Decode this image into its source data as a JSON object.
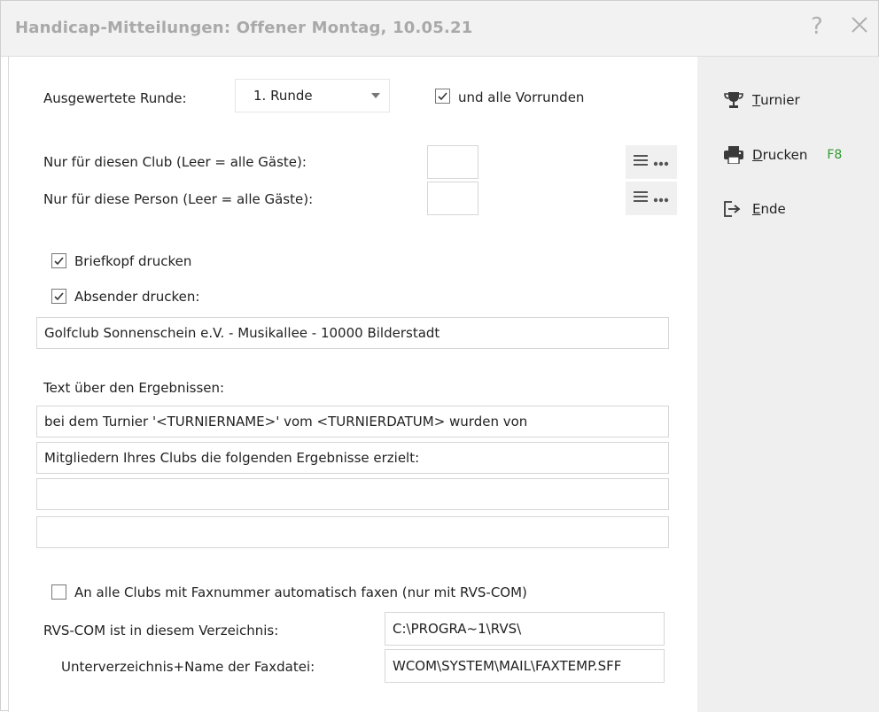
{
  "window": {
    "title": "Handicap-Mitteilungen: Offener Montag, 10.05.21",
    "help_glyph": "?"
  },
  "round": {
    "label": "Ausgewertete Runde:",
    "selected": "1. Runde",
    "all_previous_label": "und alle Vorrunden",
    "all_previous_checked": true
  },
  "club_filter": {
    "label": "Nur für diesen Club (Leer = alle Gäste):",
    "value": ""
  },
  "person_filter": {
    "label": "Nur für diese Person (Leer = alle Gäste):",
    "value": ""
  },
  "letterhead": {
    "label": "Briefkopf drucken",
    "checked": true
  },
  "sender": {
    "label": "Absender drucken:",
    "checked": true,
    "value": "Golfclub Sonnenschein e.V. - Musikallee - 10000 Bilderstadt"
  },
  "results_text": {
    "label": "Text über den Ergebnissen:",
    "lines": [
      "bei dem Turnier '<TURNIERNAME>' vom <TURNIERDATUM> wurden von",
      "Mitgliedern Ihres Clubs die folgenden Ergebnisse erzielt:",
      "",
      ""
    ]
  },
  "fax": {
    "auto_label": "An alle Clubs mit Faxnummer automatisch faxen (nur mit RVS-COM)",
    "auto_checked": false,
    "dir_label": "RVS-COM ist in diesem Verzeichnis:",
    "dir_value": "C:\\PROGRA~1\\RVS\\",
    "file_label": "Unterverzeichnis+Name der Faxdatei:",
    "file_value": "WCOM\\SYSTEM\\MAIL\\FAXTEMP.SFF"
  },
  "sidebar": {
    "turnier": {
      "first": "T",
      "rest": "urnier"
    },
    "drucken": {
      "first": "D",
      "rest": "rucken",
      "shortcut": "F8"
    },
    "ende": {
      "first": "E",
      "rest": "nde"
    }
  },
  "colors": {
    "title_text": "#a9a9a9",
    "sidebar_bg": "#efefef",
    "shortcut_green": "#2e9a2e"
  }
}
